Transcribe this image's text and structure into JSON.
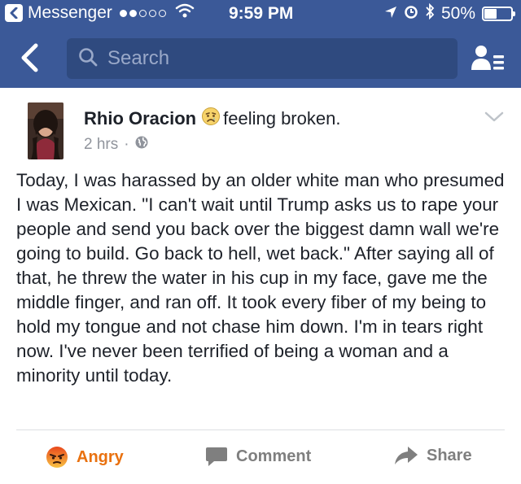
{
  "status_bar": {
    "app_back_label": "Messenger",
    "time": "9:59 PM",
    "battery_text": "50%",
    "battery_level": 0.5,
    "signal_bars_filled": 2,
    "signal_bars_total": 5
  },
  "header": {
    "search_placeholder": "Search",
    "icons": [
      "back-arrow-icon",
      "search-icon",
      "friend-requests-icon"
    ]
  },
  "post": {
    "author": "Rhio Oracion",
    "feeling_text": "feeling broken.",
    "feeling_icon": "sad-face-icon",
    "timestamp": "2 hrs",
    "separator": "·",
    "privacy_icon": "globe-icon",
    "body": "Today, I was harassed by an older white man who presumed I was Mexican. \"I can't wait until Trump asks us to rape your people and send you back over the biggest damn wall we're going to build. Go back to hell, wet back.\" After saying all of that, he threw the water in his cup in my face, gave me the middle finger, and ran off. It took every fiber of my being to hold my tongue and not chase him down. I'm in tears right now. I've never been terrified of being a woman and a minority until today."
  },
  "actions": {
    "angry_label": "Angry",
    "comment_label": "Comment",
    "share_label": "Share"
  },
  "colors": {
    "brand_blue": "#3b5998",
    "search_bg": "#2f4a7f",
    "angry_orange": "#e9710f",
    "muted_gray": "#90949c"
  }
}
